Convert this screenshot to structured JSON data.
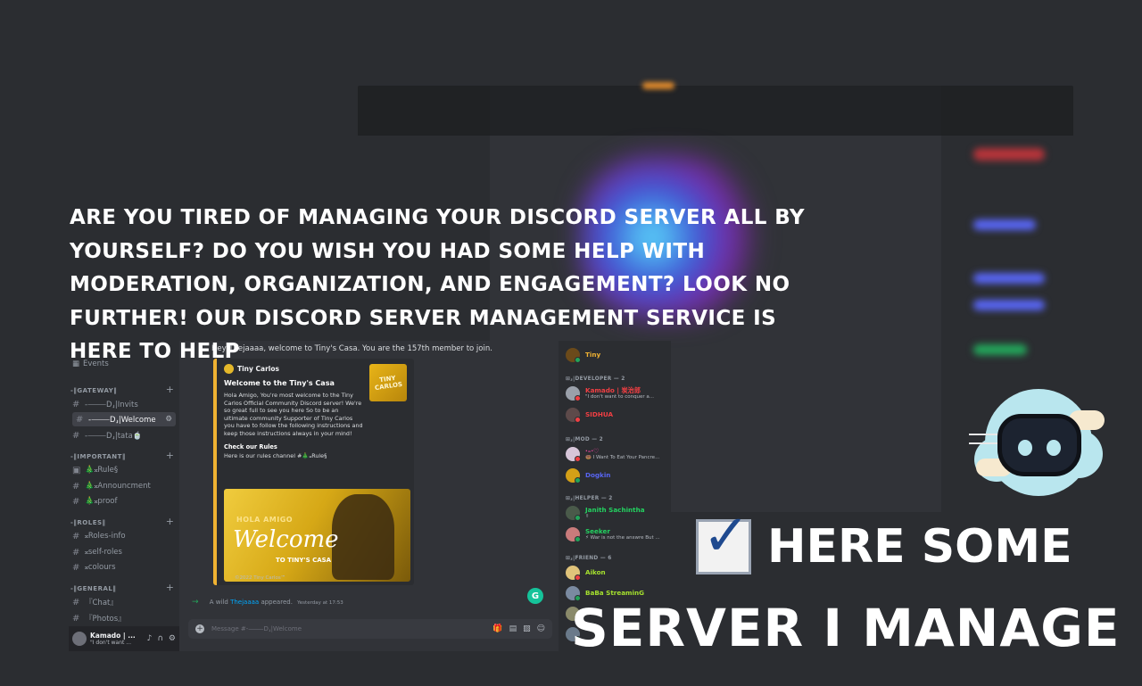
{
  "headline": "Are you tired of managing your Discord server all by yourself? Do you wish you had some help with moderation, organization, and engagement? Look no further! Our Discord server management service is here to help",
  "promo": {
    "line1": "here some",
    "line2": "server I manage"
  },
  "channels": {
    "events_label": "Events",
    "categories": [
      {
        "name": "-‖GATEWAY‖",
        "items": [
          "-⸻D⸥|Invits",
          "-⸻D⸥|Welcome",
          "-⸻D⸥|tata🍵"
        ]
      },
      {
        "name": "-‖IMPORTANT‖",
        "items": [
          "🎄𝄪Rule§",
          "🎄𝄪Announcment",
          "🎄𝄪proof"
        ]
      },
      {
        "name": "-‖ROLES‖",
        "items": [
          "𝄪Roles-info",
          "𝄪self-roles",
          "𝄪colours"
        ]
      },
      {
        "name": "-‖GENERAL‖",
        "items": [
          "『Chat』",
          "『Photos』"
        ]
      }
    ]
  },
  "user_panel": {
    "name": "Kamado | ...",
    "status": "\"I don't want ..."
  },
  "chat": {
    "welcome_text": "Hey Thejaaaa, welcome to Tiny's Casa. You are the 157th member to join.",
    "embed": {
      "author": "Tiny Carlos",
      "title": "Welcome to the Tiny's Casa",
      "description": "Hola Amigo, You're most welcome to the Tiny Carlos Official Community Discord server! We're so great full to see you here So to be an ultimate community Supporter of Tiny Carlos you have to follow the following instructions and keep those instructions always in your mind!",
      "subheading": "Check our Rules",
      "subtext": "Here is our rules channel #🎄𝄪Rule§",
      "thumb_text": "TINY CARLOS",
      "image_hola": "HOLA AMIGO",
      "image_welcome": "Welcome",
      "image_to": "TO TINY'S CASA",
      "footer": "©2022 Tiny Carlos™"
    },
    "appeared": {
      "prefix": "A wild",
      "name": "Thejaaaa",
      "suffix": "appeared.",
      "time": "Yesterday at 17:53"
    },
    "input_placeholder": "Message #-⸻D⸥|Welcome",
    "g_badge": "G"
  },
  "members": {
    "top": {
      "name": "Tiny",
      "color": "#f0b232"
    },
    "groups": [
      {
        "role": "⊞⸥|DEVELOPER — 2",
        "members": [
          {
            "name": "Kamado | 炭治郎",
            "status": "\"I don't want to conquer a...",
            "color": "#f23f43"
          },
          {
            "name": "SIDHUA",
            "status": "",
            "color": "#f23f43"
          }
        ]
      },
      {
        "role": "⊞⸥|MOD — 2",
        "members": [
          {
            "name": "·–·♡",
            "status": "🍩 I Want To Eat Your Pancre...",
            "color": "#eb459e"
          },
          {
            "name": "Dogkin",
            "status": "",
            "color": "#5865f2"
          }
        ]
      },
      {
        "role": "⊞⸥|HELPER — 2",
        "members": [
          {
            "name": "Janith Sachintha",
            "status": "✌",
            "color": "#23d160"
          },
          {
            "name": "Seeker",
            "status": "⚡ War is not the answre But ...",
            "color": "#23d160"
          }
        ]
      },
      {
        "role": "⊞⸥|FRIEND — 6",
        "members": [
          {
            "name": "Aikon",
            "status": "",
            "color": "#a6e22e"
          },
          {
            "name": "BaBa StreaminG",
            "status": "",
            "color": "#a6e22e"
          }
        ]
      }
    ]
  },
  "colors": {
    "accent": "#f0b232",
    "background": "#2b2d31",
    "discord_blurple": "#5865f2"
  }
}
